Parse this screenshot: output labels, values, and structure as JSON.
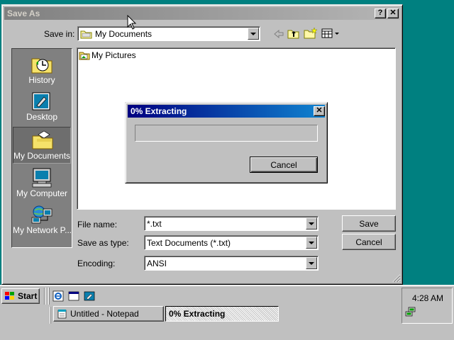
{
  "dialog": {
    "title": "Save As",
    "help_label": "?",
    "close_label": "✕",
    "save_in_label": "Save in:",
    "save_in_value": "My Documents",
    "files": [
      {
        "name": "My Pictures",
        "icon": "pictures-folder-icon"
      }
    ],
    "places": [
      {
        "label": "History",
        "icon": "history-icon"
      },
      {
        "label": "Desktop",
        "icon": "desktop-icon"
      },
      {
        "label": "My Documents",
        "icon": "my-documents-icon"
      },
      {
        "label": "My Computer",
        "icon": "my-computer-icon"
      },
      {
        "label": "My Network P...",
        "icon": "my-network-icon"
      }
    ],
    "file_name_label": "File name:",
    "file_name_value": "*.txt",
    "save_as_type_label": "Save as type:",
    "save_as_type_value": "Text Documents (*.txt)",
    "encoding_label": "Encoding:",
    "encoding_value": "ANSI",
    "save_button": "Save",
    "cancel_button": "Cancel"
  },
  "progress": {
    "title": "0% Extracting",
    "close_label": "✕",
    "percent": 0,
    "cancel_button": "Cancel"
  },
  "taskbar": {
    "start_label": "Start",
    "quick_launch": [
      "ie-icon",
      "outlook-express-icon",
      "desktop-icon"
    ],
    "tasks": [
      {
        "label": "Untitled - Notepad",
        "active": false
      },
      {
        "label": "0% Extracting",
        "active": true
      }
    ],
    "clock": "4:28 AM"
  }
}
